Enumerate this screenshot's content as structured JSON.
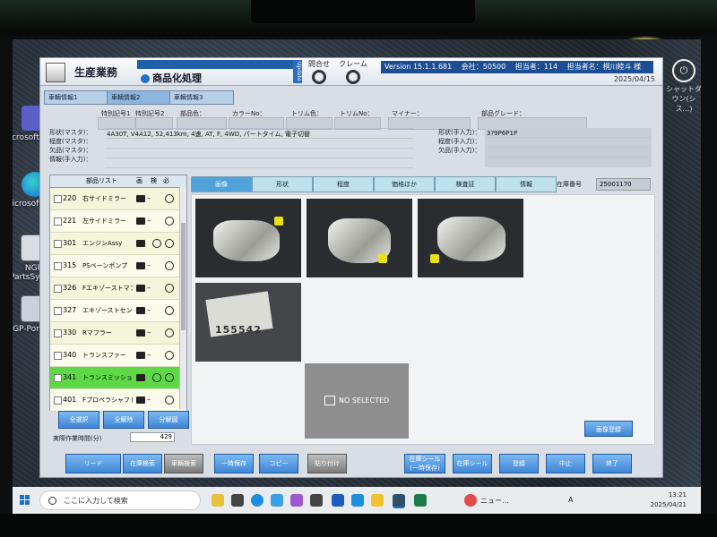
{
  "desktop": {
    "icons": [
      {
        "label": "Microsoft Teams",
        "color": "#5b5fc7"
      },
      {
        "label": "Microsoft Edge",
        "color": "#1f8fd8"
      },
      {
        "label": "NGP-PartsSystem",
        "color": "#d8dde4"
      },
      {
        "label": "NGP-PortTable",
        "color": "#c9d2dc"
      }
    ],
    "right_icon_label": "シャットダウン(シス…)"
  },
  "app": {
    "title": "生産業務",
    "module": "商品化処理",
    "update_label": "Update",
    "inquiry_label": "問合せ",
    "claim_label": "クレーム",
    "version": "Version 15.1.1.681",
    "company": "会社：50500",
    "store": "担当者：114",
    "user": "担当者名：桐川睦斗 様",
    "date": "2025/04/15",
    "tabs": [
      "車輌情報1",
      "車輌情報2",
      "車輌情報3"
    ],
    "header_fields": [
      "特別記号1",
      "特別記号2",
      "部品色：",
      "カラーNo：",
      "トリム色：",
      "トリムNo：",
      "マイナー：",
      "部品グレード："
    ],
    "left_labels": [
      "形状(マスタ)：",
      "程度(マスタ)：",
      "欠品(マスタ)：",
      "情報(手入力)："
    ],
    "spec_text": "4A30T, V4A12, 52,413km, 4速, AT, F, 4WD, パートタイム, 電子切替",
    "manual_labels": [
      "形状(手入力)：",
      "程度(手入力)：",
      "欠品(手入力)："
    ],
    "manual_value": "3?9P6P1P",
    "parts_header": {
      "title": "部品リスト",
      "col1": "画",
      "col2": "検",
      "col3": "必"
    },
    "parts": [
      {
        "code": "220",
        "name": "右サイドミラー",
        "m1": "–",
        "m2": "○"
      },
      {
        "code": "221",
        "name": "左サイドミラー",
        "m1": "–",
        "m2": "○"
      },
      {
        "code": "301",
        "name": "エンジンAssy",
        "m1": "○",
        "m2": "○"
      },
      {
        "code": "315",
        "name": "PSベーンポンプ",
        "m1": "–",
        "m2": "○"
      },
      {
        "code": "326",
        "name": "Fエキゾーストマフ",
        "m1": "–",
        "m2": "○"
      },
      {
        "code": "327",
        "name": "エキゾーストセンタ",
        "m1": "–",
        "m2": "○"
      },
      {
        "code": "330",
        "name": "Rマフラー",
        "m1": "–",
        "m2": "○"
      },
      {
        "code": "340",
        "name": "トランスファー",
        "m1": "–",
        "m2": "○"
      },
      {
        "code": "341",
        "name": "トランスミッション",
        "m1": "○",
        "m2": "○"
      },
      {
        "code": "401",
        "name": "Fプロペラシャフト",
        "m1": "–",
        "m2": "○"
      }
    ],
    "left_buttons": [
      "全選択",
      "全解除",
      "分解図"
    ],
    "work_time_label": "実際作業時間(分)",
    "work_time_value": "429",
    "detail_tabs": [
      "画像",
      "形状",
      "程度",
      "価格ほか",
      "検査証",
      "情報"
    ],
    "stock_label": "在庫番号",
    "stock_number": "25001170",
    "no_selected": "NO SELECTED",
    "image_register": "画像登録",
    "photo_label_number": "155542",
    "bottom_buttons": [
      "リード",
      "在庫検索",
      "車輌検索",
      "一時保存",
      "コピー",
      "貼り付け",
      "在庫シール(一時保存)",
      "在庫シール",
      "登録",
      "中止",
      "終了"
    ]
  },
  "taskbar": {
    "search_placeholder": "ここに入力して検索",
    "news": "ニュー…",
    "ime": "A",
    "time": "13:21",
    "date": "2025/04/21"
  }
}
